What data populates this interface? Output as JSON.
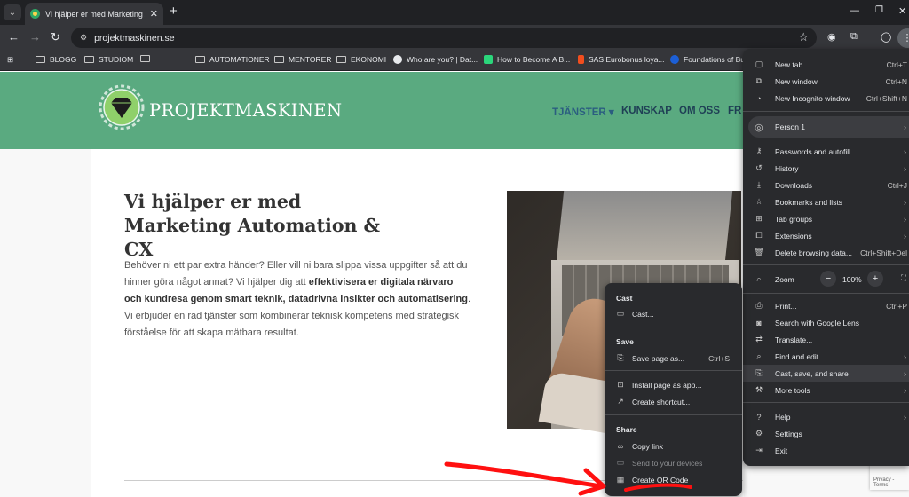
{
  "browser": {
    "tab_title": "Vi hjälper er med Marketing Au",
    "url": "projektmaskinen.se",
    "bookmarks": [
      "BLOGG",
      "STUDIOM",
      "AUTOMATIONER",
      "MENTORER",
      "EKONOMI",
      "Who are you? | Dat...",
      "How to Become A B...",
      "SAS Eurobonus loya...",
      "Foundations of Bu"
    ]
  },
  "site": {
    "logo_text": "PROJEKTMASKINEN",
    "nav": [
      "TJÄNSTER ▾",
      "KUNSKAP",
      "OM OSS",
      "FR"
    ],
    "hero_title": "Vi hjälper er med Marketing Automation & CX",
    "hero_p1_a": "Behöver ni ett par extra händer? Eller vill ni bara slippa vissa uppgifter så att du hinner göra något annat? Vi hjälper dig att ",
    "hero_p1_b": "effektivisera er digitala närvaro och kundresa genom smart teknik, datadrivna insikter och automatisering",
    "hero_p1_c": ".",
    "hero_p2": "Vi erbjuder en rad tjänster som kombinerar teknisk kompetens med strategisk förståelse för att skapa mätbara resultat."
  },
  "main_menu": {
    "new_tab": {
      "label": "New tab",
      "shortcut": "Ctrl+T"
    },
    "new_window": {
      "label": "New window",
      "shortcut": "Ctrl+N"
    },
    "new_incognito": {
      "label": "New Incognito window",
      "shortcut": "Ctrl+Shift+N"
    },
    "person": "Person 1",
    "passwords": "Passwords and autofill",
    "history": "History",
    "downloads": {
      "label": "Downloads",
      "shortcut": "Ctrl+J"
    },
    "bookmarks": "Bookmarks and lists",
    "tab_groups": "Tab groups",
    "extensions": "Extensions",
    "delete_data": {
      "label": "Delete browsing data...",
      "shortcut": "Ctrl+Shift+Del"
    },
    "zoom": {
      "label": "Zoom",
      "value": "100%",
      "minus": "−",
      "plus": "+"
    },
    "print": {
      "label": "Print...",
      "shortcut": "Ctrl+P"
    },
    "lens": "Search with Google Lens",
    "translate": "Translate...",
    "find_edit": "Find and edit",
    "cast_save_share": "Cast, save, and share",
    "more_tools": "More tools",
    "help": "Help",
    "settings": "Settings",
    "exit": "Exit"
  },
  "sub_menu": {
    "cast_head": "Cast",
    "cast": "Cast...",
    "save_head": "Save",
    "save_page": {
      "label": "Save page as...",
      "shortcut": "Ctrl+S"
    },
    "install": "Install page as app...",
    "shortcut": "Create shortcut...",
    "share_head": "Share",
    "copy_link": "Copy link",
    "send_devices": "Send to your devices",
    "qr_code": "Create QR Code"
  },
  "colors": {
    "site_green": "#5aaa80",
    "annotation_red": "#ff1010",
    "menu_bg": "#292a2d"
  },
  "recaptcha_text": "Privacy - Terms"
}
